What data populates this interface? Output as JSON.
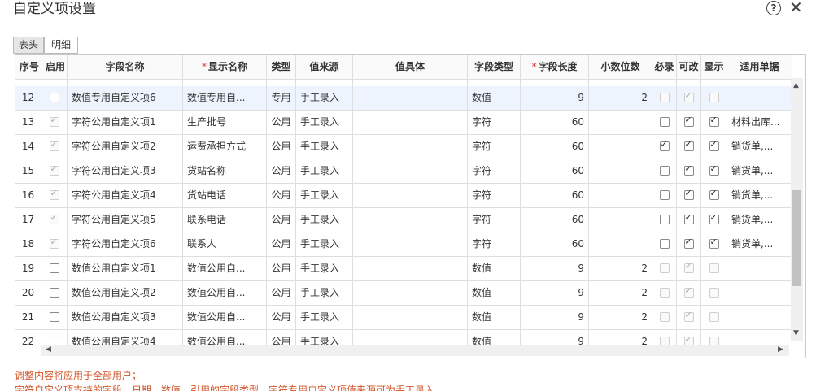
{
  "title": "自定义项设置",
  "tabs": [
    {
      "label": "表头",
      "active": true
    },
    {
      "label": "明细",
      "active": false
    }
  ],
  "columns": {
    "seq": "序号",
    "enable": "启用",
    "field_name": "字段名称",
    "display_name": "显示名称",
    "type": "类型",
    "value_source": "值来源",
    "value_detail": "值具体",
    "field_type": "字段类型",
    "field_length": "字段长度",
    "decimals": "小数位数",
    "required": "必录",
    "editable": "可改",
    "show": "显示",
    "applicable_docs": "适用单据"
  },
  "rows": [
    {
      "seq": "12",
      "enable": false,
      "enable_dis": false,
      "field_name": "数值专用自定义项6",
      "display_name": "数值专用自...",
      "type": "专用",
      "value_source": "手工录入",
      "value_detail": "",
      "field_type": "数值",
      "field_length": "9",
      "decimals": "2",
      "required": false,
      "req_dis": true,
      "editable": true,
      "edit_dis": true,
      "show": false,
      "show_dis": true,
      "applicable_docs": "",
      "selected": true
    },
    {
      "seq": "13",
      "enable": true,
      "enable_dis": true,
      "field_name": "字符公用自定义项1",
      "display_name": "生产批号",
      "type": "公用",
      "value_source": "手工录入",
      "value_detail": "",
      "field_type": "字符",
      "field_length": "60",
      "decimals": "",
      "required": false,
      "req_dis": false,
      "editable": true,
      "edit_dis": false,
      "show": true,
      "show_dis": false,
      "applicable_docs": "材料出库...",
      "selected": false
    },
    {
      "seq": "14",
      "enable": true,
      "enable_dis": true,
      "field_name": "字符公用自定义项2",
      "display_name": "运费承担方式",
      "type": "公用",
      "value_source": "手工录入",
      "value_detail": "",
      "field_type": "字符",
      "field_length": "60",
      "decimals": "",
      "required": true,
      "req_dis": false,
      "editable": true,
      "edit_dis": false,
      "show": true,
      "show_dis": false,
      "applicable_docs": "销货单,...",
      "selected": false
    },
    {
      "seq": "15",
      "enable": true,
      "enable_dis": true,
      "field_name": "字符公用自定义项3",
      "display_name": "货站名称",
      "type": "公用",
      "value_source": "手工录入",
      "value_detail": "",
      "field_type": "字符",
      "field_length": "60",
      "decimals": "",
      "required": false,
      "req_dis": false,
      "editable": true,
      "edit_dis": false,
      "show": true,
      "show_dis": false,
      "applicable_docs": "销货单,...",
      "selected": false
    },
    {
      "seq": "16",
      "enable": true,
      "enable_dis": true,
      "field_name": "字符公用自定义项4",
      "display_name": "货站电话",
      "type": "公用",
      "value_source": "手工录入",
      "value_detail": "",
      "field_type": "字符",
      "field_length": "60",
      "decimals": "",
      "required": false,
      "req_dis": false,
      "editable": true,
      "edit_dis": false,
      "show": true,
      "show_dis": false,
      "applicable_docs": "销货单,...",
      "selected": false
    },
    {
      "seq": "17",
      "enable": true,
      "enable_dis": true,
      "field_name": "字符公用自定义项5",
      "display_name": "联系电话",
      "type": "公用",
      "value_source": "手工录入",
      "value_detail": "",
      "field_type": "字符",
      "field_length": "60",
      "decimals": "",
      "required": false,
      "req_dis": false,
      "editable": true,
      "edit_dis": false,
      "show": true,
      "show_dis": false,
      "applicable_docs": "销货单,...",
      "selected": false
    },
    {
      "seq": "18",
      "enable": true,
      "enable_dis": true,
      "field_name": "字符公用自定义项6",
      "display_name": "联系人",
      "type": "公用",
      "value_source": "手工录入",
      "value_detail": "",
      "field_type": "字符",
      "field_length": "60",
      "decimals": "",
      "required": false,
      "req_dis": false,
      "editable": true,
      "edit_dis": false,
      "show": true,
      "show_dis": false,
      "applicable_docs": "销货单,...",
      "selected": false
    },
    {
      "seq": "19",
      "enable": false,
      "enable_dis": false,
      "field_name": "数值公用自定义项1",
      "display_name": "数值公用自...",
      "type": "公用",
      "value_source": "手工录入",
      "value_detail": "",
      "field_type": "数值",
      "field_length": "9",
      "decimals": "2",
      "required": false,
      "req_dis": true,
      "editable": true,
      "edit_dis": true,
      "show": false,
      "show_dis": true,
      "applicable_docs": "",
      "selected": false
    },
    {
      "seq": "20",
      "enable": false,
      "enable_dis": false,
      "field_name": "数值公用自定义项2",
      "display_name": "数值公用自...",
      "type": "公用",
      "value_source": "手工录入",
      "value_detail": "",
      "field_type": "数值",
      "field_length": "9",
      "decimals": "2",
      "required": false,
      "req_dis": true,
      "editable": true,
      "edit_dis": true,
      "show": false,
      "show_dis": true,
      "applicable_docs": "",
      "selected": false
    },
    {
      "seq": "21",
      "enable": false,
      "enable_dis": false,
      "field_name": "数值公用自定义项3",
      "display_name": "数值公用自...",
      "type": "公用",
      "value_source": "手工录入",
      "value_detail": "",
      "field_type": "数值",
      "field_length": "9",
      "decimals": "2",
      "required": false,
      "req_dis": true,
      "editable": true,
      "edit_dis": true,
      "show": false,
      "show_dis": true,
      "applicable_docs": "",
      "selected": false
    },
    {
      "seq": "22",
      "enable": false,
      "enable_dis": false,
      "field_name": "数值公用自定义项4",
      "display_name": "数值公用自...",
      "type": "公用",
      "value_source": "手工录入",
      "value_detail": "",
      "field_type": "数值",
      "field_length": "9",
      "decimals": "2",
      "required": false,
      "req_dis": true,
      "editable": true,
      "edit_dis": true,
      "show": false,
      "show_dis": true,
      "applicable_docs": "",
      "selected": false
    }
  ],
  "notes": {
    "line1": "调整内容将应用于全部用户；",
    "line2": "字符自定义项支持的字段、日期、数值、引用的字段类型、字符专用自定义项值来源可为手工录入"
  },
  "icons": {
    "help": "help-icon",
    "close": "close-icon"
  }
}
